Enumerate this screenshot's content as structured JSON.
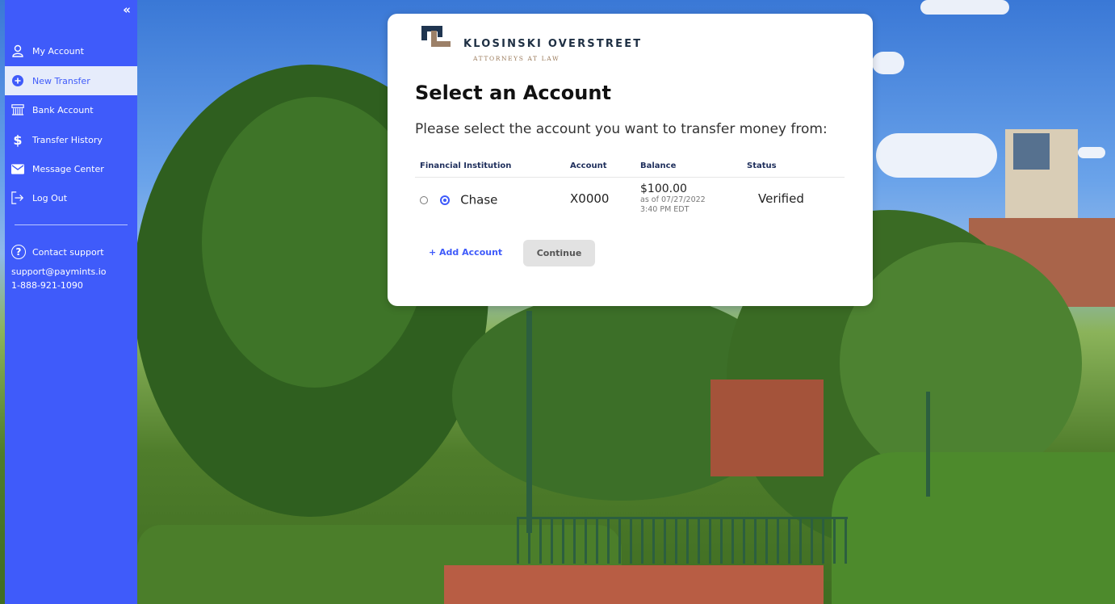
{
  "sidebar": {
    "collapse_label": "«",
    "items": [
      {
        "label": "My Account",
        "icon": "user-icon"
      },
      {
        "label": "New Transfer",
        "icon": "plus-circle-icon"
      },
      {
        "label": "Bank Account",
        "icon": "bank-icon"
      },
      {
        "label": "Transfer History",
        "icon": "dollar-icon"
      },
      {
        "label": "Message Center",
        "icon": "envelope-icon"
      },
      {
        "label": "Log Out",
        "icon": "logout-icon"
      }
    ],
    "active_item": "New Transfer",
    "support": {
      "label": "Contact support",
      "email": "support@paymints.io",
      "phone": "1-888-921-1090",
      "icon": "question-circle-icon"
    }
  },
  "card": {
    "brand": {
      "name": "KLOSINSKI OVERSTREET",
      "subtitle": "ATTORNEYS AT LAW"
    },
    "title": "Select an Account",
    "subtitle": "Please select the account you want to transfer money from:",
    "table": {
      "headers": [
        "Financial Institution",
        "Account",
        "Balance",
        "Status"
      ],
      "rows": [
        {
          "institution": "Chase",
          "account": "X0000",
          "balance": "$100.00",
          "balance_date": "as of 07/27/2022",
          "balance_time": "3:40 PM EDT",
          "status": "Verified"
        }
      ]
    },
    "add_account_label": "+ Add Account",
    "continue_label": "Continue"
  },
  "colors": {
    "accent": "#3f5bfa",
    "active_bg": "#e6ecfb",
    "continue_bg": "#e2e2e2"
  }
}
